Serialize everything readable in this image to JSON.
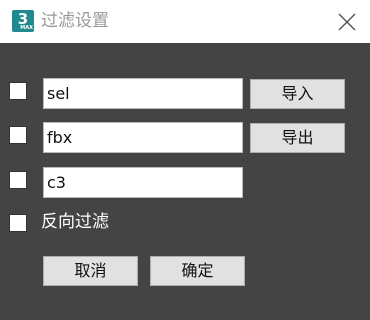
{
  "window": {
    "title": "过滤设置",
    "icon_text": "3",
    "icon_subtext": "MAX",
    "icon_name": "3ds-max-icon",
    "close_icon": "close-icon",
    "accent": "#1f8a8f",
    "background": "#444444"
  },
  "filters": [
    {
      "value": "sel",
      "checked": false
    },
    {
      "value": "fbx",
      "checked": false
    },
    {
      "value": "c3",
      "checked": false
    }
  ],
  "buttons": {
    "import_label": "导入",
    "export_label": "导出",
    "cancel_label": "取消",
    "ok_label": "确定"
  },
  "reverse_filter": {
    "label": "反向过滤",
    "checked": false
  }
}
